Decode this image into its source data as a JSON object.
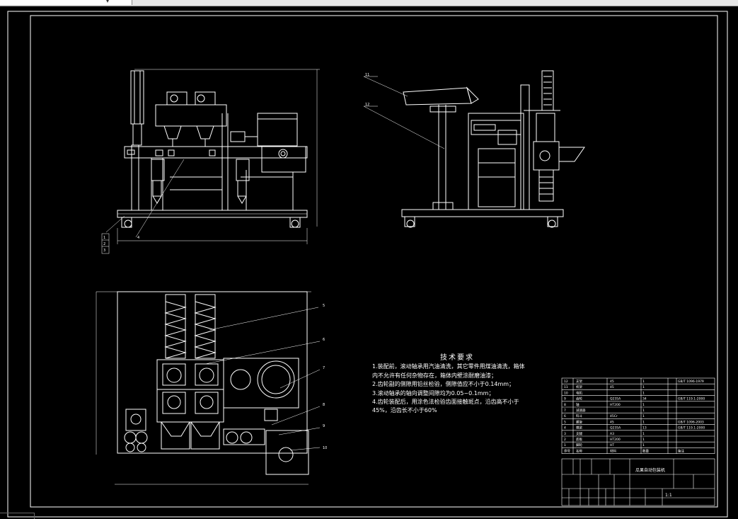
{
  "tech": {
    "title": "技术要求",
    "lines": [
      "1.装配前，滚动轴承用汽油清洗，其它零件用煤油清洗，箱体",
      "内不允许有任何杂物存在，箱体内壁涂耐磨油漆；",
      "2.齿轮副的侧隙用铅丝检验，侧隙值应不小于0.14mm；",
      "3.滚动轴承的轴向调整间隙均为0.05~0.1mm；",
      "4.齿轮装配后，用涂色法检验齿面接触斑点，沿齿高不小于",
      "45%，沿齿长不小于60%"
    ]
  },
  "callouts": [
    "11",
    "12",
    "5",
    "6",
    "7",
    "8",
    "9",
    "10",
    "1",
    "2",
    "3",
    "4"
  ],
  "bom_rows": [
    [
      "12",
      "支架",
      "45",
      "1",
      "GB/T 1096-1979"
    ],
    [
      "11",
      "机架",
      "45",
      "1",
      ""
    ],
    [
      "10",
      "电机",
      "",
      "1",
      ""
    ],
    [
      "9",
      "齿轮",
      "Q235A",
      "34",
      "GB/T 119.1-2000"
    ],
    [
      "8",
      "轴",
      "HT200",
      "1",
      ""
    ],
    [
      "7",
      "减速器",
      "",
      "1",
      ""
    ],
    [
      "6",
      "料斗",
      "45Cr",
      "1",
      ""
    ],
    [
      "5",
      "螺旋",
      "45",
      "1",
      "GB/T 1096-2003"
    ],
    [
      "4",
      "横梁",
      "Q235A",
      "13",
      "GB/T 119.1-2000"
    ],
    [
      "3",
      "支腿",
      "A3",
      "1",
      ""
    ],
    [
      "2",
      "底板",
      "HT200",
      "1",
      ""
    ],
    [
      "1",
      "脚轮",
      "HT",
      "1",
      ""
    ]
  ],
  "bom_header": [
    "序号",
    "名称",
    "材料",
    "数量",
    "备注"
  ],
  "title_block": {
    "name": "瓜果自动包装机",
    "scale": "1:1"
  },
  "colors": {
    "line": "#ffffff",
    "background": "#000000"
  }
}
